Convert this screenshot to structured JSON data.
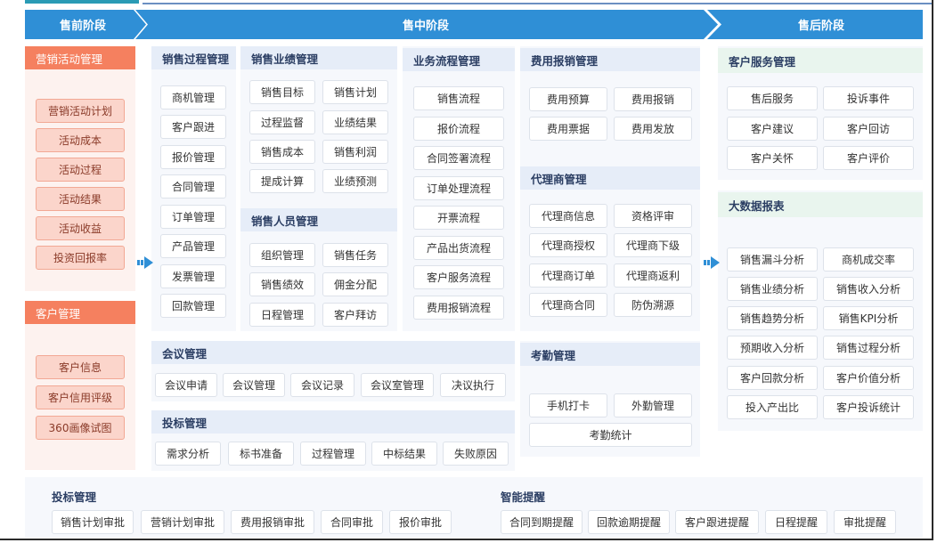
{
  "stages": [
    "售前阶段",
    "售中阶段",
    "售后阶段"
  ],
  "marketing": {
    "title": "营销活动管理",
    "items": [
      "营销活动计划",
      "活动成本",
      "活动过程",
      "活动结果",
      "活动收益",
      "投资回报率"
    ]
  },
  "customer_mgmt": {
    "title": "客户管理",
    "items": [
      "客户信息",
      "客户信用评级",
      "360画像试图"
    ]
  },
  "sales_process": {
    "title": "销售过程管理",
    "items": [
      "商机管理",
      "客户跟进",
      "报价管理",
      "合同管理",
      "订单管理",
      "产品管理",
      "发票管理",
      "回款管理"
    ]
  },
  "sales_performance": {
    "title": "销售业绩管理",
    "items": [
      "销售目标",
      "销售计划",
      "过程监督",
      "业绩结果",
      "销售成本",
      "销售利润",
      "提成计算",
      "业绩预测"
    ]
  },
  "sales_staff": {
    "title": "销售人员管理",
    "items": [
      "组织管理",
      "销售任务",
      "销售绩效",
      "佣金分配",
      "日程管理",
      "客户拜访"
    ]
  },
  "workflow": {
    "title": "业务流程管理",
    "items": [
      "销售流程",
      "报价流程",
      "合同签署流程",
      "订单处理流程",
      "开票流程",
      "产品出货流程",
      "客户服务流程",
      "费用报销流程"
    ]
  },
  "expense": {
    "title": "费用报销管理",
    "items": [
      "费用预算",
      "费用报销",
      "费用票据",
      "费用发放"
    ]
  },
  "agent": {
    "title": "代理商管理",
    "items": [
      "代理商信息",
      "资格评审",
      "代理商授权",
      "代理商下级",
      "代理商订单",
      "代理商返利",
      "代理商合同",
      "防伪溯源"
    ]
  },
  "meeting": {
    "title": "会议管理",
    "items": [
      "会议申请",
      "会议管理",
      "会议记录",
      "会议室管理",
      "决议执行"
    ]
  },
  "bidding": {
    "title": "投标管理",
    "items": [
      "需求分析",
      "标书准备",
      "过程管理",
      "中标结果",
      "失败原因"
    ]
  },
  "attendance": {
    "title": "考勤管理",
    "items": [
      "手机打卡",
      "外勤管理",
      "考勤统计"
    ]
  },
  "service": {
    "title": "客户服务管理",
    "items": [
      "售后服务",
      "投诉事件",
      "客户建议",
      "客户回访",
      "客户关怀",
      "客户评价"
    ]
  },
  "bigdata": {
    "title": "大数据报表",
    "items": [
      "销售漏斗分析",
      "商机成交率",
      "销售业绩分析",
      "销售收入分析",
      "销售趋势分析",
      "销售KPI分析",
      "预期收入分析",
      "销售过程分析",
      "客户回款分析",
      "客户价值分析",
      "投入产出比",
      "客户投诉统计"
    ]
  },
  "bottom_left": {
    "title": "投标管理",
    "items": [
      "销售计划审批",
      "营销计划审批",
      "费用报销审批",
      "合同审批",
      "报价审批"
    ]
  },
  "bottom_right": {
    "title": "智能提醒",
    "items": [
      "合同到期提醒",
      "回款逾期提醒",
      "客户跟进提醒",
      "日程提醒",
      "审批提醒"
    ]
  },
  "colors": {
    "stage_blue": "#2f8fd6",
    "accent_orange": "#f5805f",
    "panel_bg": "#f6f8fc"
  }
}
